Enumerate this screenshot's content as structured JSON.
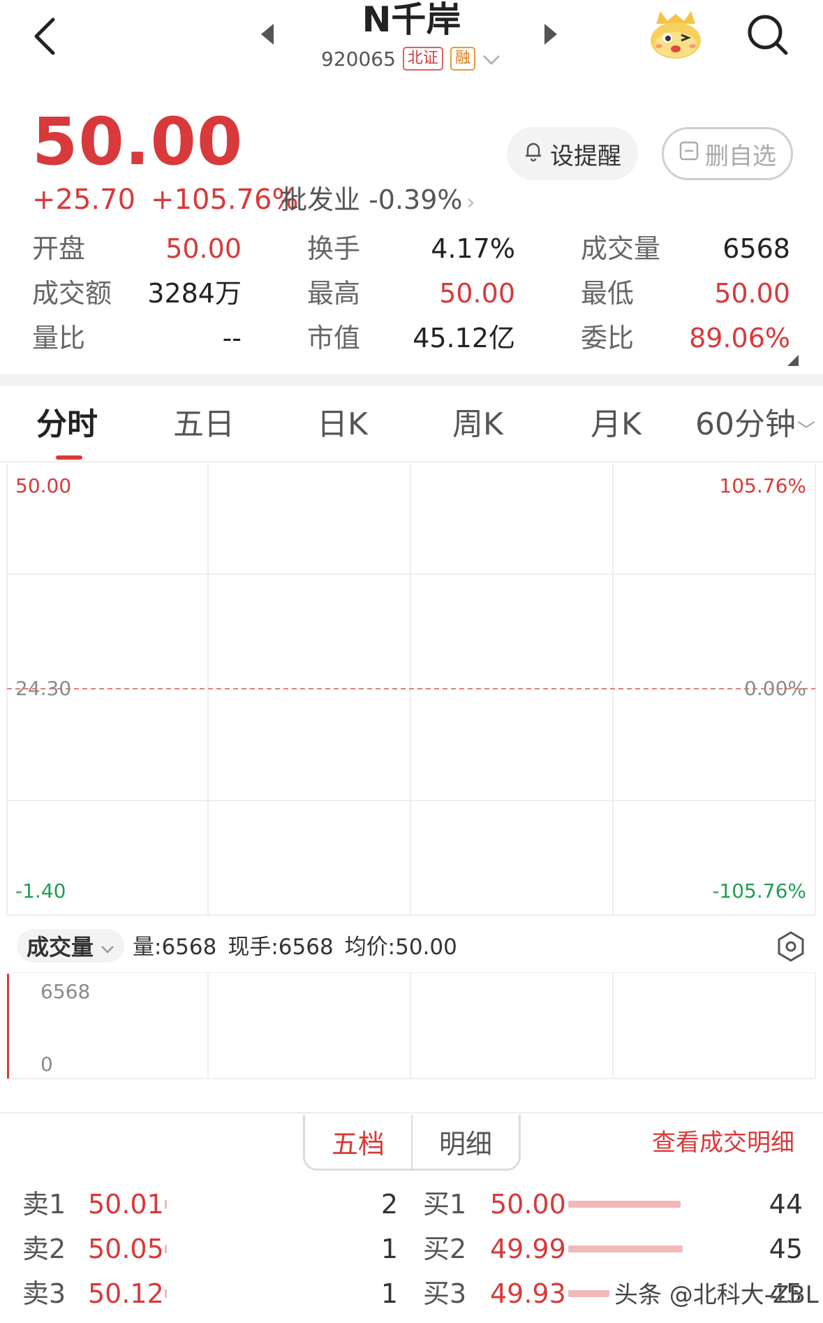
{
  "header": {
    "title": "N千岸",
    "code": "920065",
    "tag_exchange": "北证",
    "tag_margin": "融",
    "icons": [
      "back-icon",
      "prev-arrow-icon",
      "next-arrow-icon",
      "mascot-icon",
      "search-icon",
      "dropdown-chevron-icon"
    ]
  },
  "quote": {
    "price": "50.00",
    "change": "+25.70",
    "change_pct": "+105.76%",
    "industry": "批发业 -0.39%",
    "industry_chevron": "›",
    "alert_label": "设提醒",
    "delete_label": "删自选"
  },
  "stats": [
    {
      "label": "开盘",
      "value": "50.00",
      "color": "red"
    },
    {
      "label": "换手",
      "value": "4.17%",
      "color": "dark"
    },
    {
      "label": "成交量",
      "value": "6568",
      "color": "dark"
    },
    {
      "label": "成交额",
      "value": "3284万",
      "color": "dark"
    },
    {
      "label": "最高",
      "value": "50.00",
      "color": "red"
    },
    {
      "label": "最低",
      "value": "50.00",
      "color": "red"
    },
    {
      "label": "量比",
      "value": "--",
      "color": "dark"
    },
    {
      "label": "市值",
      "value": "45.12亿",
      "color": "dark"
    },
    {
      "label": "委比",
      "value": "89.06%",
      "color": "red"
    }
  ],
  "tabs": [
    "分时",
    "五日",
    "日K",
    "周K",
    "月K",
    "60分钟"
  ],
  "tab_chevron": "﹀",
  "chart": {
    "y_top": "50.00",
    "y_mid": "24.30",
    "y_bottom": "-1.40",
    "pct_top": "105.76%",
    "pct_mid": "0.00%",
    "pct_bottom": "-105.76%"
  },
  "volume": {
    "selector": "成交量",
    "vol": "量:6568",
    "now": "现手:6568",
    "avg": "均价:50.00",
    "axis_top": "6568",
    "axis_bottom": "0"
  },
  "orderbook": {
    "tab_five": "五档",
    "tab_detail": "明细",
    "view_detail": "查看成交明细",
    "asks": [
      {
        "label": "卖1",
        "price": "50.01",
        "qty": "2"
      },
      {
        "label": "卖2",
        "price": "50.05",
        "qty": "1"
      },
      {
        "label": "卖3",
        "price": "50.12",
        "qty": "1"
      }
    ],
    "bids": [
      {
        "label": "买1",
        "price": "50.00",
        "qty": "44"
      },
      {
        "label": "买2",
        "price": "49.99",
        "qty": "45"
      },
      {
        "label": "买3",
        "price": "49.93",
        "qty": "45"
      }
    ],
    "bid_levels": [
      0.98,
      1.0,
      0.36
    ]
  },
  "watermark": "头条 @北科大-ZBL",
  "colors": {
    "up": "#d8393a",
    "down": "#1f9d55",
    "bar": "#f2b9bb"
  }
}
